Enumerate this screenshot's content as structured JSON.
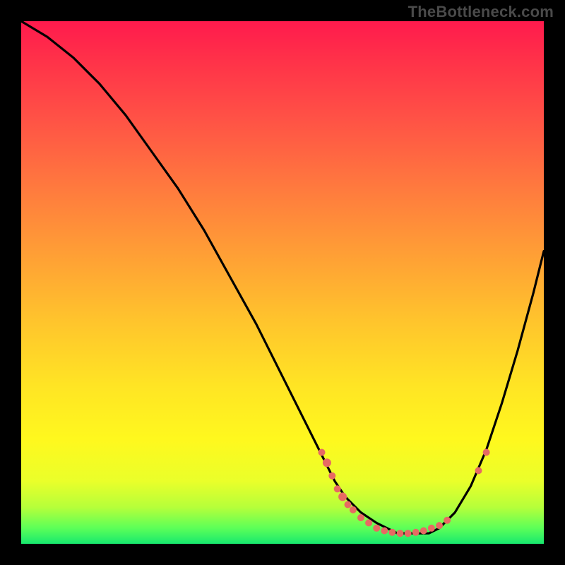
{
  "watermark": "TheBottleneck.com",
  "chart_data": {
    "type": "line",
    "title": "",
    "xlabel": "",
    "ylabel": "",
    "xlim": [
      0,
      100
    ],
    "ylim": [
      0,
      100
    ],
    "series": [
      {
        "name": "main-curve",
        "x": [
          0,
          5,
          10,
          15,
          20,
          25,
          30,
          35,
          40,
          45,
          50,
          55,
          58,
          60,
          62,
          65,
          68,
          70,
          72,
          74,
          76,
          78,
          80,
          83,
          86,
          89,
          92,
          95,
          98,
          100
        ],
        "values": [
          100,
          97,
          93,
          88,
          82,
          75,
          68,
          60,
          51,
          42,
          32,
          22,
          16,
          12,
          9,
          6,
          4,
          3,
          2,
          2,
          2,
          2,
          3,
          6,
          11,
          18,
          27,
          37,
          48,
          56
        ]
      }
    ],
    "markers": [
      {
        "x": 57.5,
        "y": 17.5,
        "r": 5
      },
      {
        "x": 58.5,
        "y": 15.5,
        "r": 6
      },
      {
        "x": 59.5,
        "y": 13.0,
        "r": 5
      },
      {
        "x": 60.5,
        "y": 10.5,
        "r": 5
      },
      {
        "x": 61.5,
        "y": 9.0,
        "r": 6
      },
      {
        "x": 62.5,
        "y": 7.5,
        "r": 5
      },
      {
        "x": 63.5,
        "y": 6.5,
        "r": 5
      },
      {
        "x": 65.0,
        "y": 5.0,
        "r": 5
      },
      {
        "x": 66.5,
        "y": 4.0,
        "r": 5
      },
      {
        "x": 68.0,
        "y": 3.0,
        "r": 5
      },
      {
        "x": 69.5,
        "y": 2.5,
        "r": 5
      },
      {
        "x": 71.0,
        "y": 2.2,
        "r": 5
      },
      {
        "x": 72.5,
        "y": 2.0,
        "r": 5
      },
      {
        "x": 74.0,
        "y": 2.0,
        "r": 5
      },
      {
        "x": 75.5,
        "y": 2.2,
        "r": 5
      },
      {
        "x": 77.0,
        "y": 2.5,
        "r": 5
      },
      {
        "x": 78.5,
        "y": 3.0,
        "r": 5
      },
      {
        "x": 80.0,
        "y": 3.5,
        "r": 5
      },
      {
        "x": 81.5,
        "y": 4.5,
        "r": 5
      },
      {
        "x": 87.5,
        "y": 14.0,
        "r": 5
      },
      {
        "x": 89.0,
        "y": 17.5,
        "r": 5
      }
    ],
    "gradient_stops": [
      {
        "pos": 0,
        "color": "#ff1a4d"
      },
      {
        "pos": 7,
        "color": "#ff3049"
      },
      {
        "pos": 18,
        "color": "#ff5046"
      },
      {
        "pos": 32,
        "color": "#ff7a3e"
      },
      {
        "pos": 45,
        "color": "#ffa035"
      },
      {
        "pos": 58,
        "color": "#ffc62c"
      },
      {
        "pos": 70,
        "color": "#ffe524"
      },
      {
        "pos": 80,
        "color": "#fff81e"
      },
      {
        "pos": 88,
        "color": "#eaff2a"
      },
      {
        "pos": 93,
        "color": "#b6ff3a"
      },
      {
        "pos": 97,
        "color": "#5cff58"
      },
      {
        "pos": 100,
        "color": "#17e86e"
      }
    ]
  }
}
